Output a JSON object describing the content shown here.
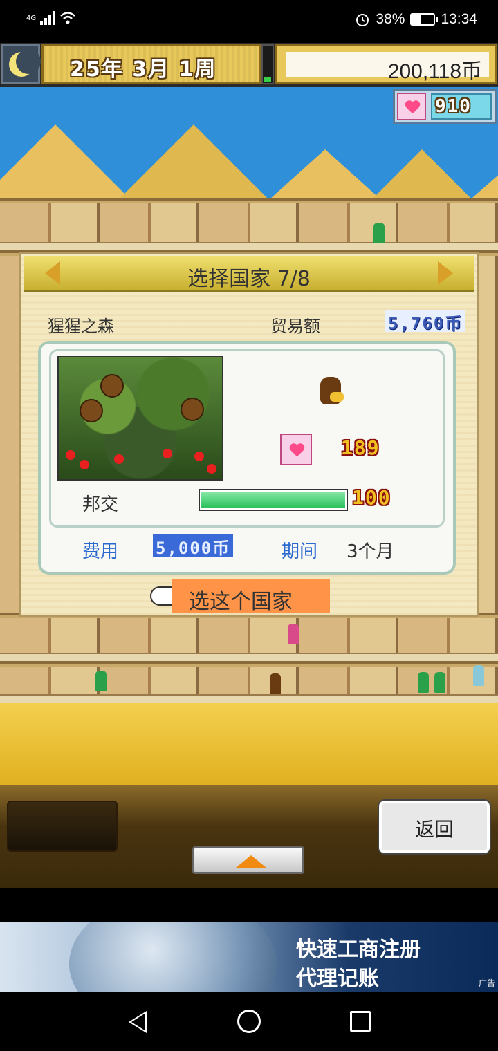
{
  "status_bar": {
    "network": "4G",
    "battery": "38%",
    "battery_level": 0.38,
    "time": "13:34"
  },
  "hud": {
    "date": "25年 3月 1周",
    "money": "200,118币",
    "hearts": "910"
  },
  "dialog": {
    "title": "选择国家 7/8",
    "country_name": "猩猩之森",
    "trade_label": "贸易额",
    "trade_value": "5,760币",
    "friendship_value": "189",
    "diplomacy_label": "邦交",
    "diplomacy_value": "100",
    "diplomacy_level": 1.0,
    "cost_label": "费用",
    "cost_value": "5,000币",
    "period_label": "期间",
    "period_value": "3个月",
    "select_label": "选这个国家"
  },
  "controls": {
    "back_label": "返回"
  },
  "ad": {
    "line1": "快速工商注册",
    "line2": "代理记账",
    "tag": "广告"
  }
}
